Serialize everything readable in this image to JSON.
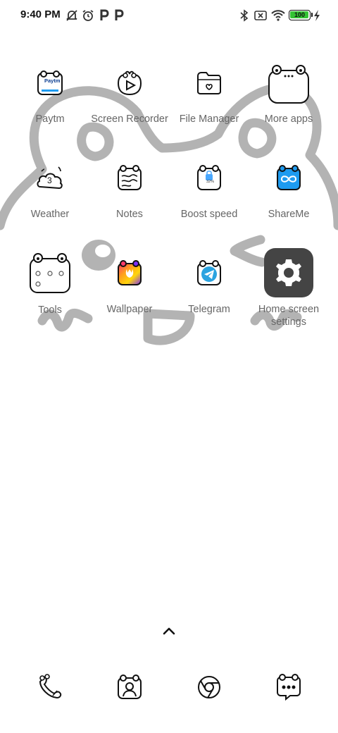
{
  "status_bar": {
    "time": "9:40 PM",
    "icons_left": [
      "mute-icon",
      "alarm-icon",
      "parking-p-icon",
      "parking-p-icon"
    ],
    "icons_right": [
      "bluetooth-icon",
      "no-sim-icon",
      "wifi-icon",
      "battery-icon",
      "charging-icon"
    ],
    "battery_level": "100"
  },
  "apps": [
    {
      "label": "Paytm",
      "icon": "paytm-icon",
      "icon_text": "Paytm"
    },
    {
      "label": "Screen Recorder",
      "icon": "screen-recorder-icon"
    },
    {
      "label": "File Manager",
      "icon": "file-manager-icon"
    },
    {
      "label": "More apps",
      "icon": "more-apps-folder-icon"
    },
    {
      "label": "Weather",
      "icon": "weather-icon",
      "icon_text": "3"
    },
    {
      "label": "Notes",
      "icon": "notes-icon"
    },
    {
      "label": "Boost speed",
      "icon": "boost-speed-icon",
      "icon_text": "32%"
    },
    {
      "label": "ShareMe",
      "icon": "shareme-icon"
    },
    {
      "label": "Tools",
      "icon": "tools-folder-icon"
    },
    {
      "label": "Wallpaper",
      "icon": "wallpaper-icon"
    },
    {
      "label": "Telegram",
      "icon": "telegram-icon"
    },
    {
      "label": "Home screen settings",
      "icon": "home-screen-settings-icon"
    }
  ],
  "app_drawer_hint": "chevron-up-icon",
  "dock": [
    {
      "icon": "phone-frog-icon"
    },
    {
      "icon": "contacts-frog-icon"
    },
    {
      "icon": "chrome-icon"
    },
    {
      "icon": "messages-frog-icon"
    }
  ],
  "colors": {
    "accent_blue": "#1d9bf0",
    "battery_green": "#34c234",
    "settings_bg": "#444444",
    "doodle_gray": "#b3b3b3"
  }
}
